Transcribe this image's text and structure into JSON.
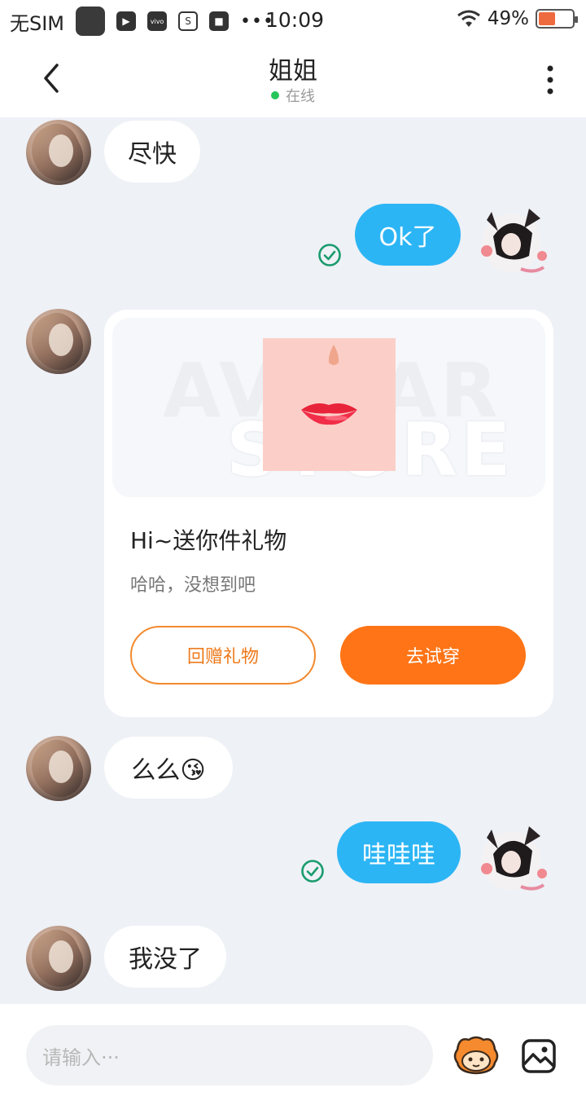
{
  "status_bar": {
    "carrier": "无SIM",
    "time": "10:09",
    "battery": "49%",
    "battery_level": 0.49
  },
  "header": {
    "title": "姐姐",
    "status": "在线"
  },
  "messages": [
    {
      "from": "her",
      "text": "尽快"
    },
    {
      "from": "me",
      "text": "Ok了"
    },
    {
      "from": "her",
      "text": "么么😘"
    },
    {
      "from": "me",
      "text": "哇哇哇"
    },
    {
      "from": "her",
      "text": "我没了"
    }
  ],
  "gift_card": {
    "watermark_line1": "AVATAR",
    "watermark_line2": "STORE",
    "title": "Hi~送你件礼物",
    "subtitle": "哈哈，没想到吧",
    "return_gift_label": "回赠礼物",
    "try_on_label": "去试穿"
  },
  "input": {
    "placeholder": "请输入···"
  },
  "colors": {
    "outgoing_bubble": "#2cb5f5",
    "accent_orange": "#fe7416",
    "online_dot": "#26c55a",
    "sent_check": "#1a9c6e"
  }
}
